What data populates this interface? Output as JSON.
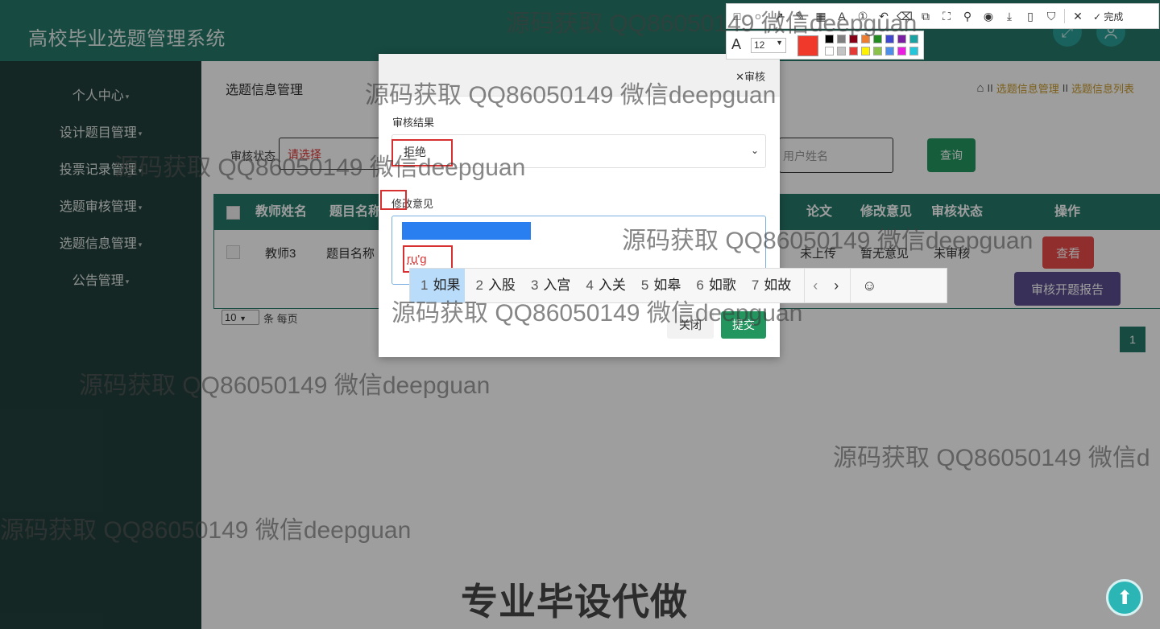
{
  "app": {
    "title": "高校毕业选题管理系统",
    "header_icons": [
      "fullscreen-icon",
      "user-icon"
    ]
  },
  "sidebar": {
    "items": [
      {
        "label": "个人中心"
      },
      {
        "label": "设计题目管理"
      },
      {
        "label": "投票记录管理"
      },
      {
        "label": "选题审核管理"
      },
      {
        "label": "选题信息管理"
      },
      {
        "label": "公告管理"
      }
    ]
  },
  "page": {
    "title": "选题信息管理",
    "breadcrumb": {
      "home_icon": "home-icon",
      "sep": "II",
      "items": [
        "选题信息管理",
        "选题信息列表"
      ]
    }
  },
  "search": {
    "status_label": "审核状态",
    "status_value": "请选择",
    "user_placeholder": "用户姓名",
    "query_label": "查询"
  },
  "table": {
    "headers": [
      "教师姓名",
      "题目名称",
      "论文",
      "修改意见",
      "审核状态",
      "操作"
    ],
    "rows": [
      {
        "teacher": "教师3",
        "topic": "题目名称",
        "paper": "未上传",
        "opinion": "暂无意见",
        "status": "未审核",
        "view": "查看",
        "review": "审核开题报告"
      }
    ]
  },
  "pagination": {
    "page_size": "10",
    "page_size_label": "条 每页",
    "current": "1"
  },
  "modal": {
    "title": "审核",
    "result_label": "审核结果",
    "result_value": "拒绝",
    "opinion_label": "修改意见",
    "ime_input": "ru'g",
    "close_label": "关闭",
    "submit_label": "提交"
  },
  "ime": {
    "candidates": [
      {
        "num": "1",
        "text": "如果"
      },
      {
        "num": "2",
        "text": "入股"
      },
      {
        "num": "3",
        "text": "入宫"
      },
      {
        "num": "4",
        "text": "入关"
      },
      {
        "num": "5",
        "text": "如皋"
      },
      {
        "num": "6",
        "text": "如歌"
      },
      {
        "num": "7",
        "text": "如故"
      }
    ],
    "prev": "‹",
    "next": "›",
    "emoji": "☺"
  },
  "screenshot_tool": {
    "done_label": "完成",
    "font_size": "12",
    "current_color": "#f0392b",
    "palette": [
      "#000000",
      "#7f7f7f",
      "#880015",
      "#ed7d31",
      "#228b22",
      "#3f48cc",
      "#7b1fa2",
      "#1ba1a1",
      "#ffffff",
      "#c3c3c3",
      "#e53935",
      "#fff200",
      "#8bc34a",
      "#4d8fe8",
      "#e91ee0",
      "#26c6da"
    ]
  },
  "watermark": "源码获取 QQ86050149 微信deepguan",
  "watermark_cut": "源码获取 QQ86050149 微信d",
  "bottom_caption": "专业毕设代做",
  "colors": {
    "header": "#26786a",
    "sidebar": "#22403b",
    "accent_green": "#239660",
    "danger": "#e84a4a",
    "purple": "#5b4e8f",
    "gold": "#c89a2c"
  }
}
